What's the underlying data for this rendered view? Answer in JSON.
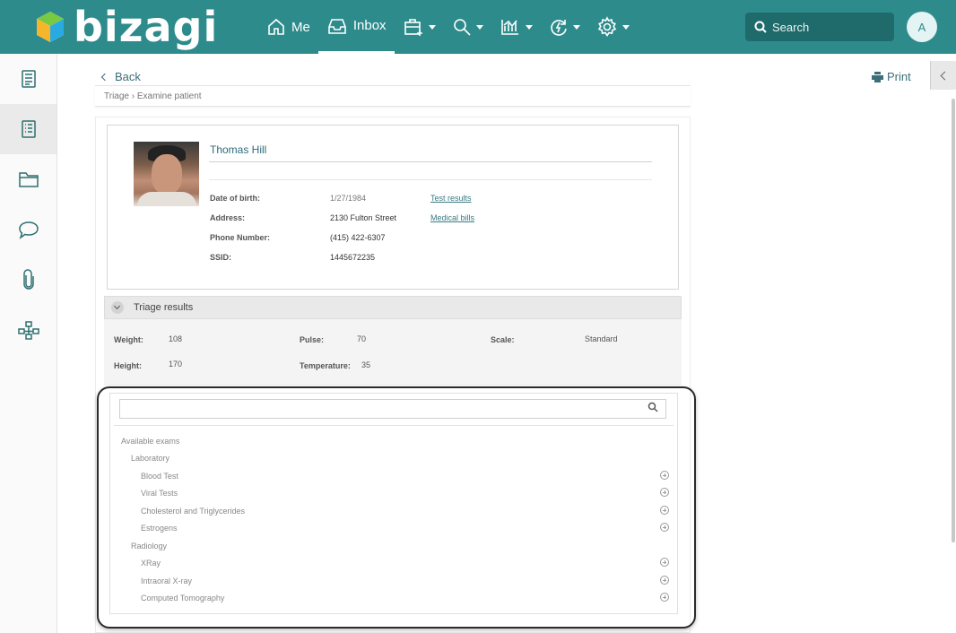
{
  "app": {
    "brand": "bizagi",
    "nav": [
      {
        "label": "Me",
        "icon": "home-icon"
      },
      {
        "label": "Inbox",
        "icon": "inbox-icon",
        "active": true
      },
      {
        "label": "",
        "icon": "new-case-icon"
      },
      {
        "label": "",
        "icon": "search-icon"
      },
      {
        "label": "",
        "icon": "analytics-icon"
      },
      {
        "label": "",
        "icon": "activity-icon"
      },
      {
        "label": "",
        "icon": "gear-icon"
      }
    ],
    "search_placeholder": "Search",
    "avatar_initial": "A",
    "accent_color": "#2e8b8c"
  },
  "sidebar": [
    "case-summary-icon",
    "activity-form-icon",
    "folder-icon",
    "comments-icon",
    "attachments-icon",
    "process-map-icon"
  ],
  "toolbar": {
    "back_label": "Back",
    "print_label": "Print"
  },
  "breadcrumb": "Triage › Examine patient",
  "patient": {
    "name": "Thomas Hill",
    "fields": [
      {
        "label": "Date of birth:",
        "value": "1/27/1984"
      },
      {
        "label": "Address:",
        "value": "2130 Fulton Street"
      },
      {
        "label": "Phone Number:",
        "value": "(415) 422-6307"
      },
      {
        "label": "SSID:",
        "value": "1445672235"
      }
    ],
    "links": [
      "Test results",
      "Medical bills"
    ]
  },
  "triage": {
    "title": "Triage results",
    "weight_label": "Weight:",
    "weight": "108",
    "height_label": "Height:",
    "height": "170",
    "pulse_label": "Pulse:",
    "pulse": "70",
    "temperature_label": "Temperature:",
    "temperature": "35",
    "scale_label": "Scale:",
    "scale": "Standard"
  },
  "exams": {
    "search_value": "",
    "root": "Available exams",
    "groups": [
      {
        "name": "Laboratory",
        "items": [
          "Blood Test",
          "Viral Tests",
          "Cholesterol and Triglycerides",
          "Estrogens"
        ]
      },
      {
        "name": "Radiology",
        "items": [
          "XRay",
          "Intraoral X-ray",
          "Computed Tomography"
        ]
      }
    ]
  }
}
